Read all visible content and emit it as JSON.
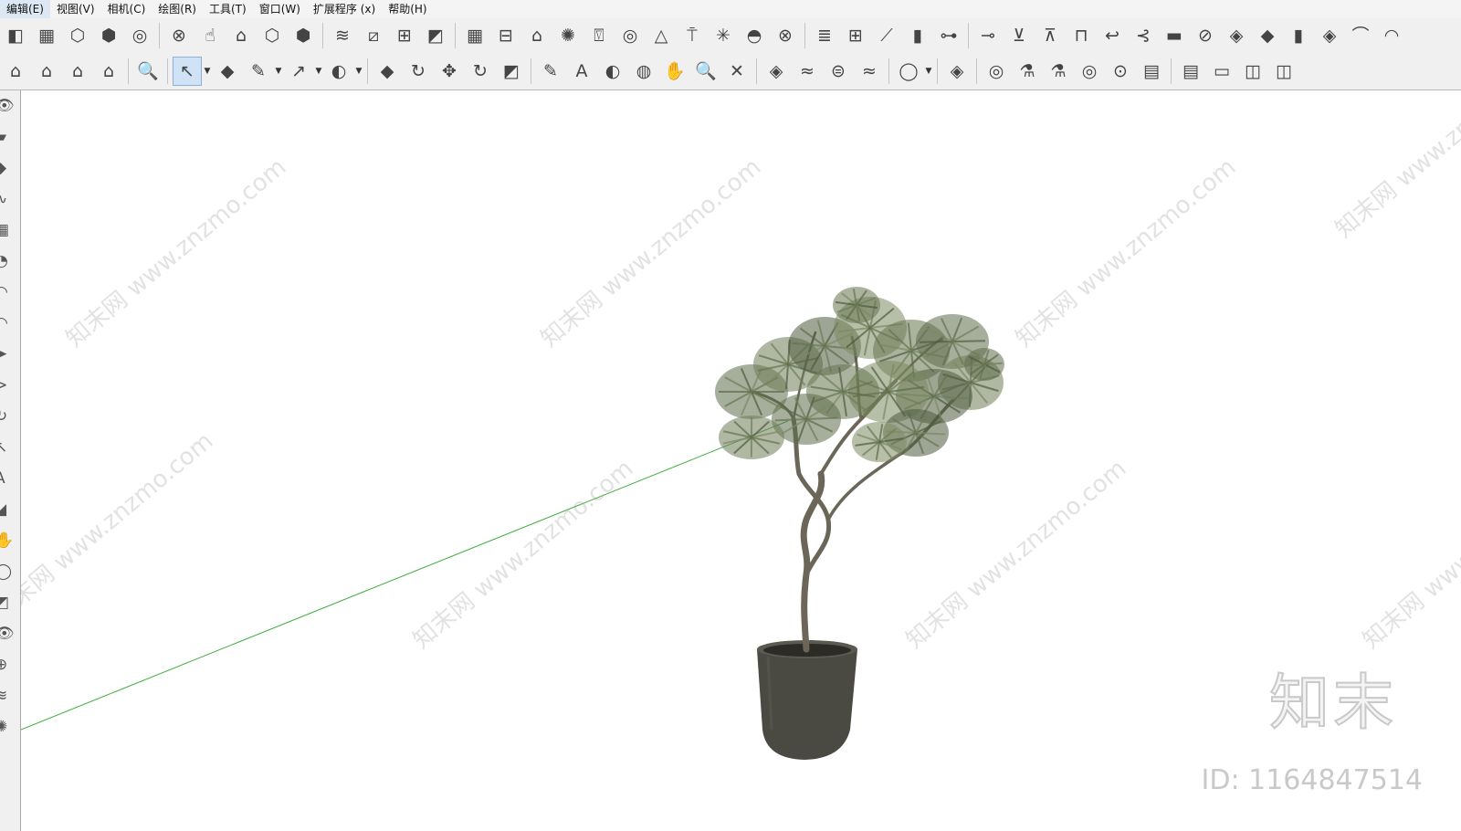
{
  "menubar": {
    "items": [
      "编辑(E)",
      "视图(V)",
      "相机(C)",
      "绘图(R)",
      "工具(T)",
      "窗口(W)",
      "扩展程序 (x)",
      "帮助(H)"
    ]
  },
  "toolbar1": {
    "icons": [
      "◧",
      "▦",
      "⬡",
      "⬢",
      "◎",
      "⊗",
      "☝",
      "⌂",
      "⬡",
      "⬢",
      "≋",
      "⧄",
      "⊞",
      "◩",
      "▦",
      "⊟",
      "⌂",
      "✺",
      "⍔",
      "◎",
      "△",
      "⍑",
      "✳",
      "◓",
      "⊗",
      "≣",
      "⊞",
      "⟋",
      "▮",
      "⊶",
      "⊸",
      "⊻",
      "⊼",
      "⊓",
      "↩",
      "⊰",
      "▬",
      "⊘",
      "◈",
      "◆",
      "▮",
      "◈",
      "⌒",
      "◠"
    ]
  },
  "toolbar2": {
    "icons": [
      "⌂",
      "⌂",
      "⌂",
      "⌂",
      "🔍",
      "↖",
      "◆",
      "✎",
      "↗",
      "◐",
      "◆",
      "↻",
      "✥",
      "↻",
      "◩",
      "✎",
      "A",
      "◐",
      "◍",
      "✋",
      "🔍",
      "✕",
      "◈",
      "≈",
      "⊜",
      "≈",
      "◯",
      "◈",
      "◎",
      "⚗",
      "⚗",
      "◎",
      "⊙",
      "▤",
      "▤",
      "▭",
      "◫",
      "◫"
    ],
    "active_index": 5
  },
  "left_toolbar": {
    "icons": [
      "👁",
      "▰",
      "◆",
      "∿",
      "▦",
      "◔",
      "◠",
      "◠",
      "➤",
      "⊳",
      "↻",
      "↖",
      "A",
      "◢",
      "✋",
      "◯",
      "◩",
      "👁",
      "⊕",
      "≋",
      "✺"
    ]
  },
  "viewport": {
    "watermark_text": "知末网 www.znzmo.com",
    "brand_logo": "知末",
    "brand_id": "ID: 1164847514",
    "axis_color": "#3fae3f"
  }
}
